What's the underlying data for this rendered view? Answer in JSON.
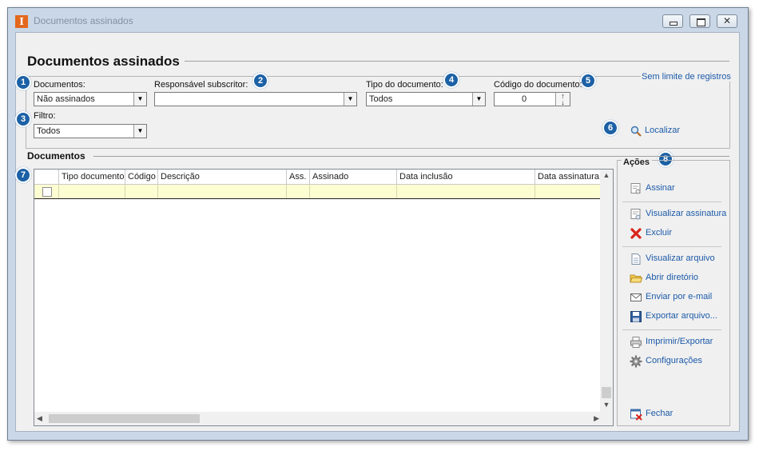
{
  "window": {
    "title": "Documentos assinados",
    "app_icon_letter": "I",
    "controls": {
      "minimize": "",
      "maximize": "",
      "close": "✕"
    }
  },
  "header": {
    "title": "Documentos assinados",
    "limit_link": "Sem limite de registros"
  },
  "filters": {
    "documentos": {
      "label": "Documentos:",
      "value": "Não assinados",
      "badge": "1"
    },
    "responsavel": {
      "label": "Responsável subscritor:",
      "value": "",
      "badge": "2"
    },
    "filtro": {
      "label": "Filtro:",
      "value": "Todos",
      "badge": "3"
    },
    "tipo": {
      "label": "Tipo do documento:",
      "value": "Todos",
      "badge": "4"
    },
    "codigo": {
      "label": "Código do documento:",
      "value": "0",
      "badge": "5"
    },
    "localizar": {
      "label": "Localizar",
      "badge": "6"
    }
  },
  "documents": {
    "section_title": "Documentos",
    "badge": "7",
    "columns": [
      "Tipo documento",
      "Código",
      "Descrição",
      "Ass.",
      "Assinado",
      "Data inclusão",
      "Data assinatura"
    ]
  },
  "actions": {
    "title": "Ações",
    "badge": "8",
    "items": [
      {
        "label": "Assinar",
        "icon": "sign-icon"
      },
      {
        "label": "Visualizar assinatura",
        "icon": "view-signature-icon"
      },
      {
        "label": "Excluir",
        "icon": "delete-icon"
      },
      {
        "label": "Visualizar arquivo",
        "icon": "file-icon"
      },
      {
        "label": "Abrir diretório",
        "icon": "folder-icon"
      },
      {
        "label": "Enviar por e-mail",
        "icon": "email-icon"
      },
      {
        "label": "Exportar arquivo...",
        "icon": "save-icon"
      },
      {
        "label": "Imprimir/Exportar",
        "icon": "printer-icon"
      },
      {
        "label": "Configurações",
        "icon": "gear-icon"
      },
      {
        "label": "Fechar",
        "icon": "close-window-icon"
      }
    ]
  },
  "colors": {
    "accent": "#1c5aa8",
    "badge": "#1c61a6",
    "row_highlight": "#fdfdd2",
    "frame": "#c9d7e7"
  }
}
